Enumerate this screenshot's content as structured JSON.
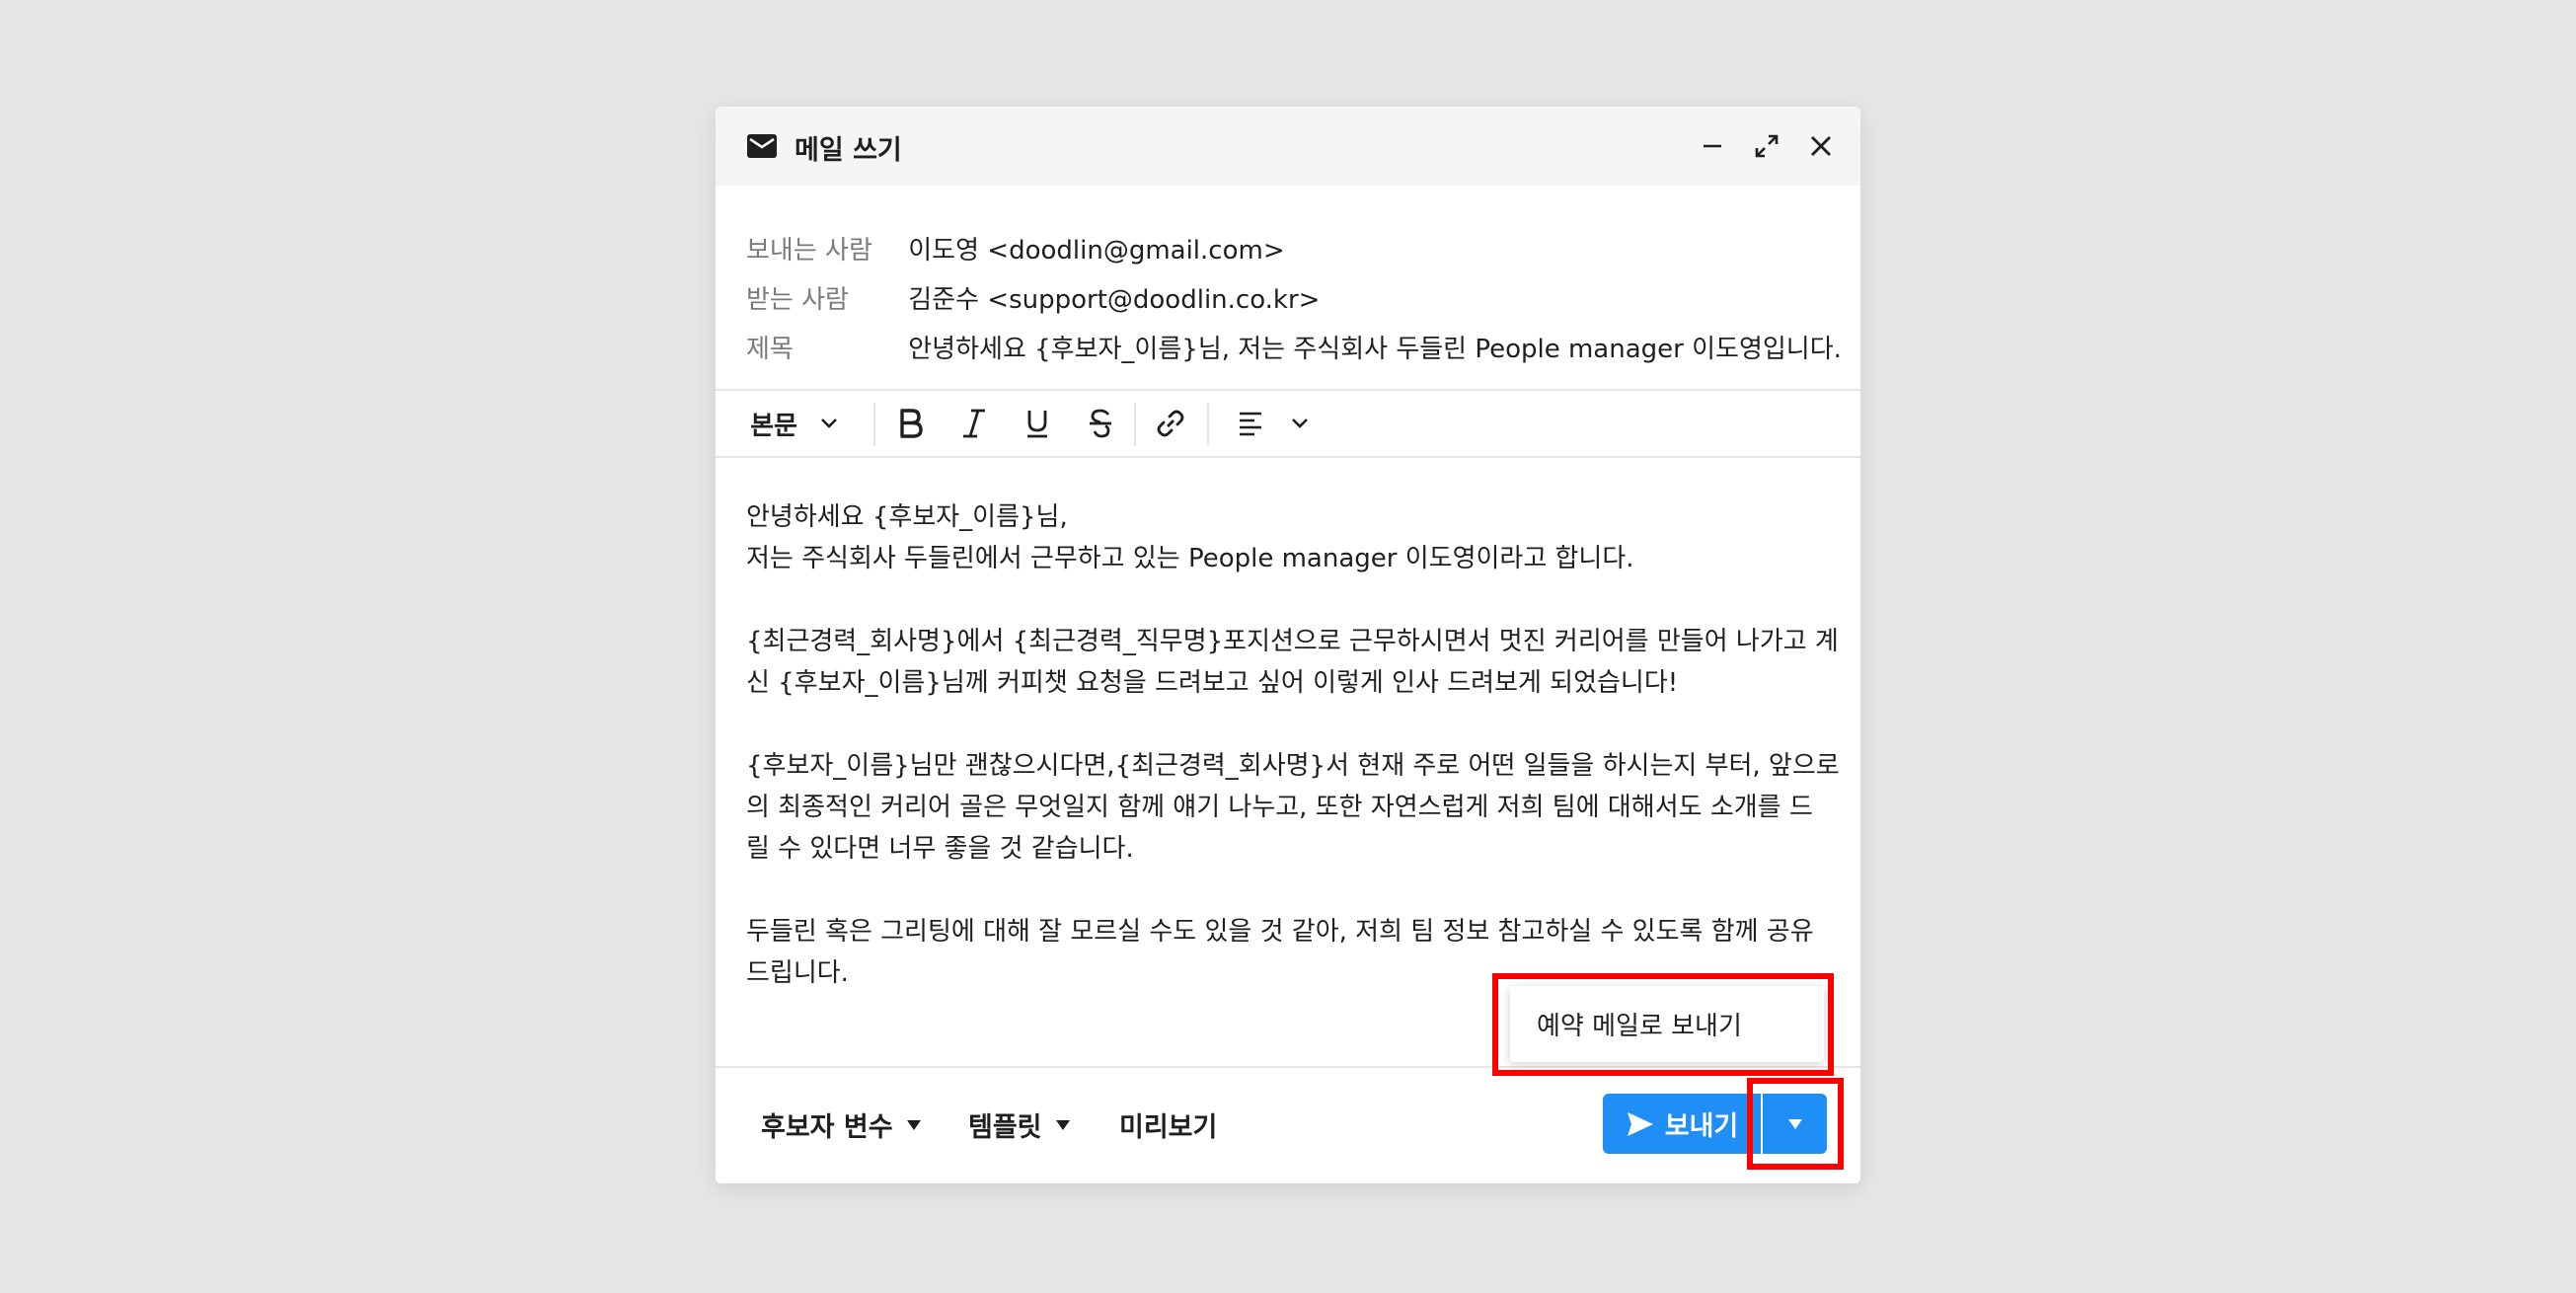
{
  "window": {
    "title": "메일 쓰기"
  },
  "fields": [
    {
      "label": "보내는 사람",
      "value": "이도영 <doodlin@gmail.com>"
    },
    {
      "label": "받는 사람",
      "value": "김준수 <support@doodlin.co.kr>"
    },
    {
      "label": "제목",
      "value": "안녕하세요 {후보자_이름}님, 저는 주식회사 두들린 People manager 이도영입니다."
    }
  ],
  "toolbar": {
    "text_style": "본문"
  },
  "body": {
    "lines": [
      "안녕하세요 {후보자_이름}님,",
      "저는 주식회사 두들린에서 근무하고 있는 People manager 이도영이라고 합니다.",
      "",
      "{최근경력_회사명}에서 {최근경력_직무명}포지션으로 근무하시면서 멋진 커리어를 만들어 나가고 계",
      "신 {후보자_이름}님께 커피챗 요청을 드려보고 싶어 이렇게 인사 드려보게 되었습니다!",
      "",
      "{후보자_이름}님만 괜찮으시다면,{최근경력_회사명}서 현재 주로 어떤 일들을 하시는지 부터, 앞으로",
      "의 최종적인 커리어 골은 무엇일지 함께 얘기 나누고, 또한 자연스럽게 저희 팀에 대해서도 소개를 드",
      "릴 수 있다면 너무 좋을 것 같습니다.",
      "",
      "두들린 혹은 그리팅에 대해 잘 모르실 수도 있을 것 같아, 저희 팀 정보 참고하실 수 있도록 함께 공유",
      "드립니다."
    ]
  },
  "footer": {
    "candidate_vars": "후보자 변수",
    "template": "템플릿",
    "preview": "미리보기",
    "send": "보내기"
  },
  "dropdown": {
    "scheduled_send": "예약 메일로 보내기"
  },
  "colors": {
    "accent": "#1f8ff5",
    "highlight": "#ff0000",
    "background": "#e6e6e6"
  }
}
